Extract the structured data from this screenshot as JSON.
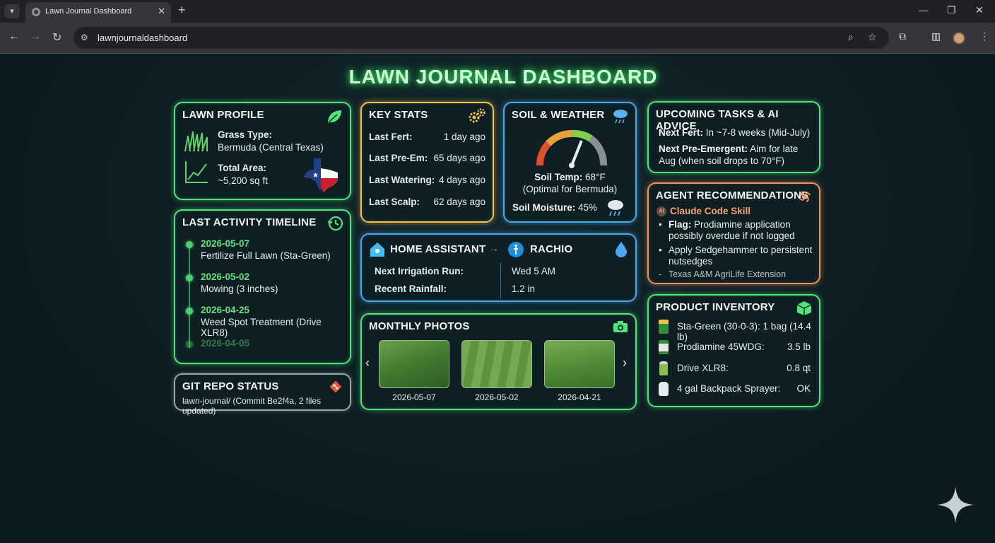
{
  "browser": {
    "tab_title": "Lawn Journal Dashboard",
    "url": "lawnjournaldashboard"
  },
  "dashboard": {
    "title": "LAWN JOURNAL DASHBOARD",
    "lawn_profile": {
      "title": "LAWN PROFILE",
      "grass_label": "Grass Type:",
      "grass_value": "Bermuda (Central Texas)",
      "area_label": "Total Area:",
      "area_value": "~5,200 sq ft"
    },
    "key_stats": {
      "title": "KEY STATS",
      "rows": [
        {
          "label": "Last Fert:",
          "value": "1 day ago"
        },
        {
          "label": "Last Pre-Em:",
          "value": "65 days ago"
        },
        {
          "label": "Last Watering:",
          "value": "4 days ago"
        },
        {
          "label": "Last Scalp:",
          "value": "62 days ago"
        }
      ]
    },
    "soil_weather": {
      "title": "SOIL & WEATHER",
      "temp_label": "Soil Temp:",
      "temp_value": "68°F",
      "temp_note": "(Optimal for Bermuda)",
      "moisture_label": "Soil Moisture:",
      "moisture_value": "45%"
    },
    "upcoming": {
      "title": "UPCOMING TASKS & AI ADVICE",
      "next_fert_label": "Next Fert:",
      "next_fert_value": "In ~7-8 weeks (Mid-July)",
      "next_pre_label": "Next Pre-Emergent:",
      "next_pre_value_1": "Aim for late",
      "next_pre_value_2": "Aug (when soil drops to 70°F)"
    },
    "timeline": {
      "title": "LAST ACTIVITY TIMELINE",
      "items": [
        {
          "date": "2026-05-07",
          "desc": "Fertilize Full Lawn (Sta-Green)"
        },
        {
          "date": "2026-05-02",
          "desc": "Mowing (3 inches)"
        },
        {
          "date": "2026-04-25",
          "desc": "Weed Spot Treatment (Drive XLR8)"
        },
        {
          "date": "2026-04-05",
          "desc": ""
        }
      ]
    },
    "integration": {
      "home_assistant": "HOME ASSISTANT",
      "rachio": "RACHIO",
      "next_run_label": "Next Irrigation Run:",
      "next_run_value": "Wed 5 AM",
      "rainfall_label": "Recent Rainfall:",
      "rainfall_value": "1.2 in"
    },
    "agent": {
      "title": "AGENT RECOMMENDATIONS",
      "badge": "AI",
      "skill": "Claude Code Skill",
      "flag_label": "Flag:",
      "flag_line_1": "Prodiamine application",
      "flag_line_2": "possibly overdue if not logged",
      "apply_line_1": "Apply Sedgehammer to persistent",
      "apply_line_2": "nutsedges",
      "source": "Texas A&M AgriLife Extension"
    },
    "photos": {
      "title": "MONTHLY PHOTOS",
      "captions": [
        "2026-05-07",
        "2026-05-02",
        "2026-04-21"
      ]
    },
    "git": {
      "title": "GIT REPO STATUS",
      "status": "lawn-journal/ (Commit Be2f4a, 2 files updated)"
    },
    "inventory": {
      "title": "PRODUCT INVENTORY",
      "items": [
        {
          "name": "Sta-Green (30-0-3): 1 bag (14.4 lb)",
          "qty": ""
        },
        {
          "name": "Prodiamine 45WDG:",
          "qty": "3.5 lb"
        },
        {
          "name": "Drive XLR8:",
          "qty": "0.8 qt"
        },
        {
          "name": "4 gal Backpack Sprayer:",
          "qty": "OK"
        }
      ]
    },
    "gauge_level": 0.62,
    "colors": {
      "green": "#4fe37a",
      "yellow": "#f2c14e",
      "blue": "#4aa8f0",
      "orange": "#f0925a"
    }
  }
}
